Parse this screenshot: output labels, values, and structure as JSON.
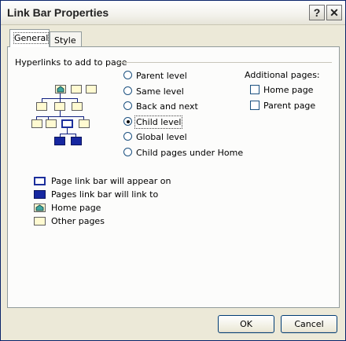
{
  "window": {
    "title": "Link Bar Properties",
    "help_glyph": "?",
    "close_glyph": "✕"
  },
  "tabs": [
    {
      "label": "General",
      "active": true
    },
    {
      "label": "Style",
      "active": false
    }
  ],
  "general": {
    "group_label": "Hyperlinks to add to page",
    "options": [
      {
        "label": "Parent level",
        "accesskey": "P",
        "checked": false
      },
      {
        "label": "Same level",
        "accesskey": "S",
        "checked": false
      },
      {
        "label": "Back and next",
        "accesskey": "B",
        "checked": false
      },
      {
        "label": "Child level",
        "accesskey": "C",
        "checked": true
      },
      {
        "label": "Global level",
        "accesskey": "G",
        "checked": false
      },
      {
        "label": "Child pages under Home",
        "accesskey": "d",
        "checked": false
      }
    ],
    "additional": {
      "label": "Additional pages:",
      "items": [
        {
          "label": "Home page",
          "accesskey": "H",
          "checked": false
        },
        {
          "label": "Parent page",
          "accesskey": "a",
          "checked": false
        }
      ]
    },
    "legend": [
      {
        "icon": "page-link-bar-icon",
        "label": "Page link bar will appear on"
      },
      {
        "icon": "linked-page-icon",
        "label": "Pages link bar will link to"
      },
      {
        "icon": "home-page-icon",
        "label": "Home page"
      },
      {
        "icon": "other-page-icon",
        "label": "Other pages"
      }
    ]
  },
  "footer": {
    "ok_label": "OK",
    "cancel_label": "Cancel"
  },
  "colors": {
    "link_blue": "#1627a0",
    "page_yellow": "#fffad1",
    "home_teal": "#3fa7a0"
  }
}
